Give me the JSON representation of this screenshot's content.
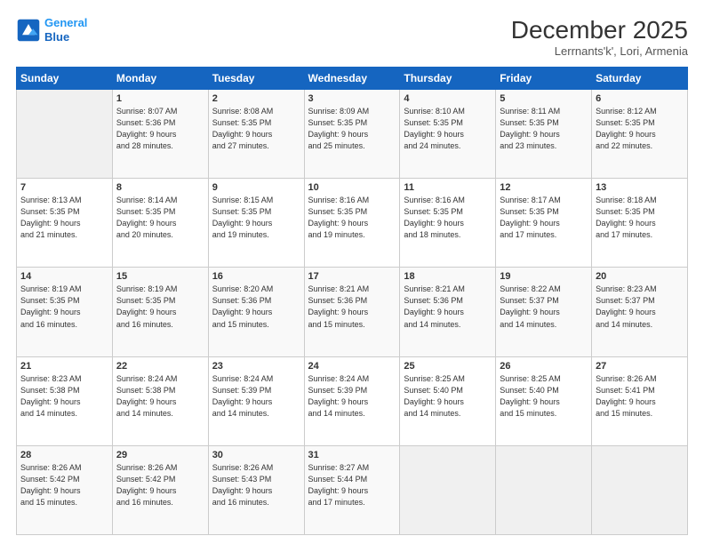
{
  "header": {
    "logo_line1": "General",
    "logo_line2": "Blue",
    "month": "December 2025",
    "location": "Lerrnants'k', Lori, Armenia"
  },
  "weekdays": [
    "Sunday",
    "Monday",
    "Tuesday",
    "Wednesday",
    "Thursday",
    "Friday",
    "Saturday"
  ],
  "weeks": [
    [
      {
        "day": "",
        "info": ""
      },
      {
        "day": "1",
        "info": "Sunrise: 8:07 AM\nSunset: 5:36 PM\nDaylight: 9 hours\nand 28 minutes."
      },
      {
        "day": "2",
        "info": "Sunrise: 8:08 AM\nSunset: 5:35 PM\nDaylight: 9 hours\nand 27 minutes."
      },
      {
        "day": "3",
        "info": "Sunrise: 8:09 AM\nSunset: 5:35 PM\nDaylight: 9 hours\nand 25 minutes."
      },
      {
        "day": "4",
        "info": "Sunrise: 8:10 AM\nSunset: 5:35 PM\nDaylight: 9 hours\nand 24 minutes."
      },
      {
        "day": "5",
        "info": "Sunrise: 8:11 AM\nSunset: 5:35 PM\nDaylight: 9 hours\nand 23 minutes."
      },
      {
        "day": "6",
        "info": "Sunrise: 8:12 AM\nSunset: 5:35 PM\nDaylight: 9 hours\nand 22 minutes."
      }
    ],
    [
      {
        "day": "7",
        "info": "Sunrise: 8:13 AM\nSunset: 5:35 PM\nDaylight: 9 hours\nand 21 minutes."
      },
      {
        "day": "8",
        "info": "Sunrise: 8:14 AM\nSunset: 5:35 PM\nDaylight: 9 hours\nand 20 minutes."
      },
      {
        "day": "9",
        "info": "Sunrise: 8:15 AM\nSunset: 5:35 PM\nDaylight: 9 hours\nand 19 minutes."
      },
      {
        "day": "10",
        "info": "Sunrise: 8:16 AM\nSunset: 5:35 PM\nDaylight: 9 hours\nand 19 minutes."
      },
      {
        "day": "11",
        "info": "Sunrise: 8:16 AM\nSunset: 5:35 PM\nDaylight: 9 hours\nand 18 minutes."
      },
      {
        "day": "12",
        "info": "Sunrise: 8:17 AM\nSunset: 5:35 PM\nDaylight: 9 hours\nand 17 minutes."
      },
      {
        "day": "13",
        "info": "Sunrise: 8:18 AM\nSunset: 5:35 PM\nDaylight: 9 hours\nand 17 minutes."
      }
    ],
    [
      {
        "day": "14",
        "info": "Sunrise: 8:19 AM\nSunset: 5:35 PM\nDaylight: 9 hours\nand 16 minutes."
      },
      {
        "day": "15",
        "info": "Sunrise: 8:19 AM\nSunset: 5:35 PM\nDaylight: 9 hours\nand 16 minutes."
      },
      {
        "day": "16",
        "info": "Sunrise: 8:20 AM\nSunset: 5:36 PM\nDaylight: 9 hours\nand 15 minutes."
      },
      {
        "day": "17",
        "info": "Sunrise: 8:21 AM\nSunset: 5:36 PM\nDaylight: 9 hours\nand 15 minutes."
      },
      {
        "day": "18",
        "info": "Sunrise: 8:21 AM\nSunset: 5:36 PM\nDaylight: 9 hours\nand 14 minutes."
      },
      {
        "day": "19",
        "info": "Sunrise: 8:22 AM\nSunset: 5:37 PM\nDaylight: 9 hours\nand 14 minutes."
      },
      {
        "day": "20",
        "info": "Sunrise: 8:23 AM\nSunset: 5:37 PM\nDaylight: 9 hours\nand 14 minutes."
      }
    ],
    [
      {
        "day": "21",
        "info": "Sunrise: 8:23 AM\nSunset: 5:38 PM\nDaylight: 9 hours\nand 14 minutes."
      },
      {
        "day": "22",
        "info": "Sunrise: 8:24 AM\nSunset: 5:38 PM\nDaylight: 9 hours\nand 14 minutes."
      },
      {
        "day": "23",
        "info": "Sunrise: 8:24 AM\nSunset: 5:39 PM\nDaylight: 9 hours\nand 14 minutes."
      },
      {
        "day": "24",
        "info": "Sunrise: 8:24 AM\nSunset: 5:39 PM\nDaylight: 9 hours\nand 14 minutes."
      },
      {
        "day": "25",
        "info": "Sunrise: 8:25 AM\nSunset: 5:40 PM\nDaylight: 9 hours\nand 14 minutes."
      },
      {
        "day": "26",
        "info": "Sunrise: 8:25 AM\nSunset: 5:40 PM\nDaylight: 9 hours\nand 15 minutes."
      },
      {
        "day": "27",
        "info": "Sunrise: 8:26 AM\nSunset: 5:41 PM\nDaylight: 9 hours\nand 15 minutes."
      }
    ],
    [
      {
        "day": "28",
        "info": "Sunrise: 8:26 AM\nSunset: 5:42 PM\nDaylight: 9 hours\nand 15 minutes."
      },
      {
        "day": "29",
        "info": "Sunrise: 8:26 AM\nSunset: 5:42 PM\nDaylight: 9 hours\nand 16 minutes."
      },
      {
        "day": "30",
        "info": "Sunrise: 8:26 AM\nSunset: 5:43 PM\nDaylight: 9 hours\nand 16 minutes."
      },
      {
        "day": "31",
        "info": "Sunrise: 8:27 AM\nSunset: 5:44 PM\nDaylight: 9 hours\nand 17 minutes."
      },
      {
        "day": "",
        "info": ""
      },
      {
        "day": "",
        "info": ""
      },
      {
        "day": "",
        "info": ""
      }
    ]
  ]
}
